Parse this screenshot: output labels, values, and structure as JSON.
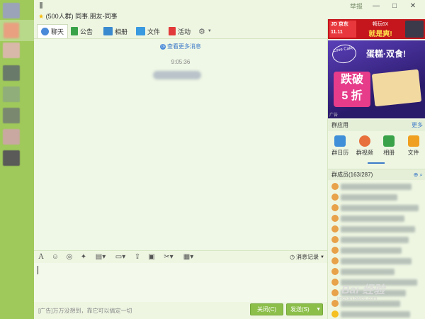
{
  "header": {
    "group_meta_star": "★",
    "group_meta": "(500人群) 同事.朋友-同事",
    "controls": {
      "report": "举报",
      "minimize": "—",
      "maximize": "□",
      "close": "✕"
    }
  },
  "tabs": [
    {
      "label": "聊天",
      "icon": "chat-icon"
    },
    {
      "label": "公告",
      "icon": "announcement-flag-icon"
    },
    {
      "label": "相册",
      "icon": "photo-album-icon"
    },
    {
      "label": "文件",
      "icon": "folder-icon"
    },
    {
      "label": "活动",
      "icon": "event-flag-icon"
    }
  ],
  "chat": {
    "more_messages": "查看更多消息",
    "timestamp": "9:05:36"
  },
  "toolbar": {
    "font": "A",
    "emoji": "☺",
    "msg_record": "消息记录"
  },
  "bottom": {
    "ad_text": "[广告]万万没想到，靠它可以搞定一切",
    "close_btn": "关闭(C)",
    "send_btn": "发送(S)"
  },
  "ads": {
    "jd_logo": "JD 京东",
    "jd_event": "11.11",
    "jd_line1": "畅玩6X",
    "jd_line2": "就是爽!",
    "cake_logo": "Love Cake",
    "cake_slogan": "蛋糕·双食!",
    "cake_line1": "跌破",
    "cake_line2": "5 折",
    "ad_tag": "广告"
  },
  "group_apps": {
    "title": "群应用",
    "more": "更多",
    "items": [
      {
        "label": "群日历",
        "icon": "calendar-icon",
        "color": "#3f8fd8"
      },
      {
        "label": "群视频",
        "icon": "video-icon",
        "color": "#e8703c"
      },
      {
        "label": "相册",
        "icon": "album-icon",
        "color": "#3aa34a"
      },
      {
        "label": "文件",
        "icon": "file-icon",
        "color": "#f0a020"
      }
    ]
  },
  "members": {
    "title": "群成员(163/287)"
  },
  "watermark": {
    "logo": "Bai 经验",
    "url": "jingyan.baidu.com"
  },
  "colors": {
    "left_strip": "#9fc95a",
    "background": "#eef6e2",
    "button": "#8cbf4a",
    "link": "#3c7ac8"
  }
}
